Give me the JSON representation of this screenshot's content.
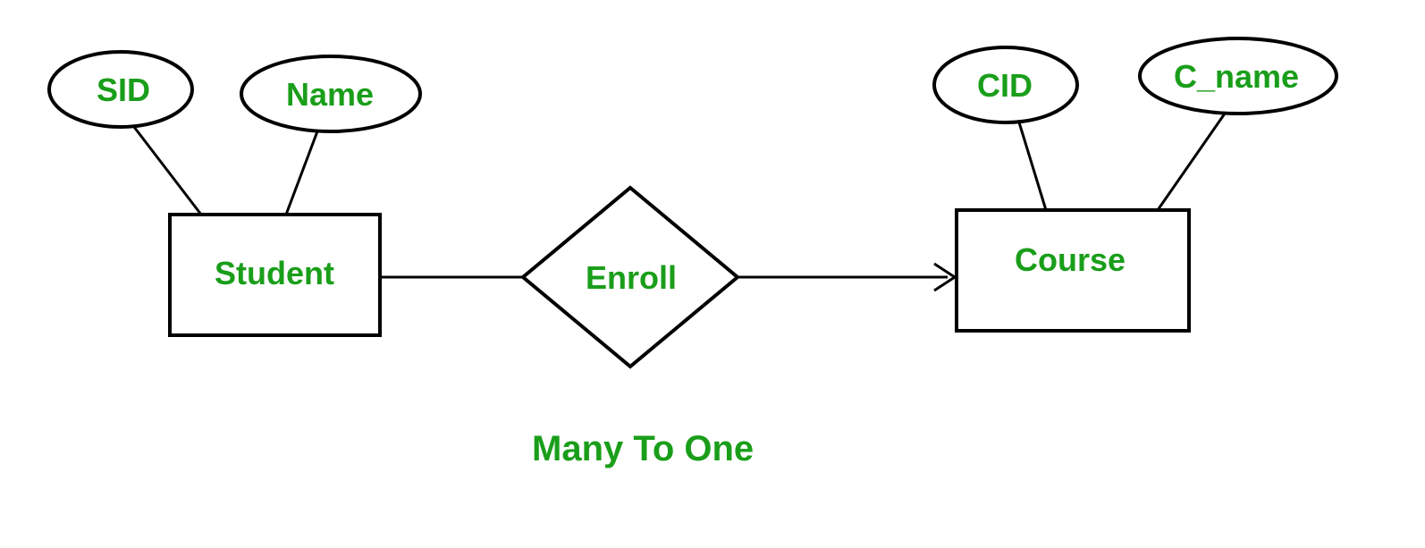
{
  "entities": {
    "student": {
      "label": "Student",
      "attributes": {
        "sid": "SID",
        "name": "Name"
      }
    },
    "course": {
      "label": "Course",
      "attributes": {
        "cid": "CID",
        "cname": "C_name"
      }
    }
  },
  "relationship": {
    "label": "Enroll"
  },
  "cardinality_caption": "Many To One"
}
